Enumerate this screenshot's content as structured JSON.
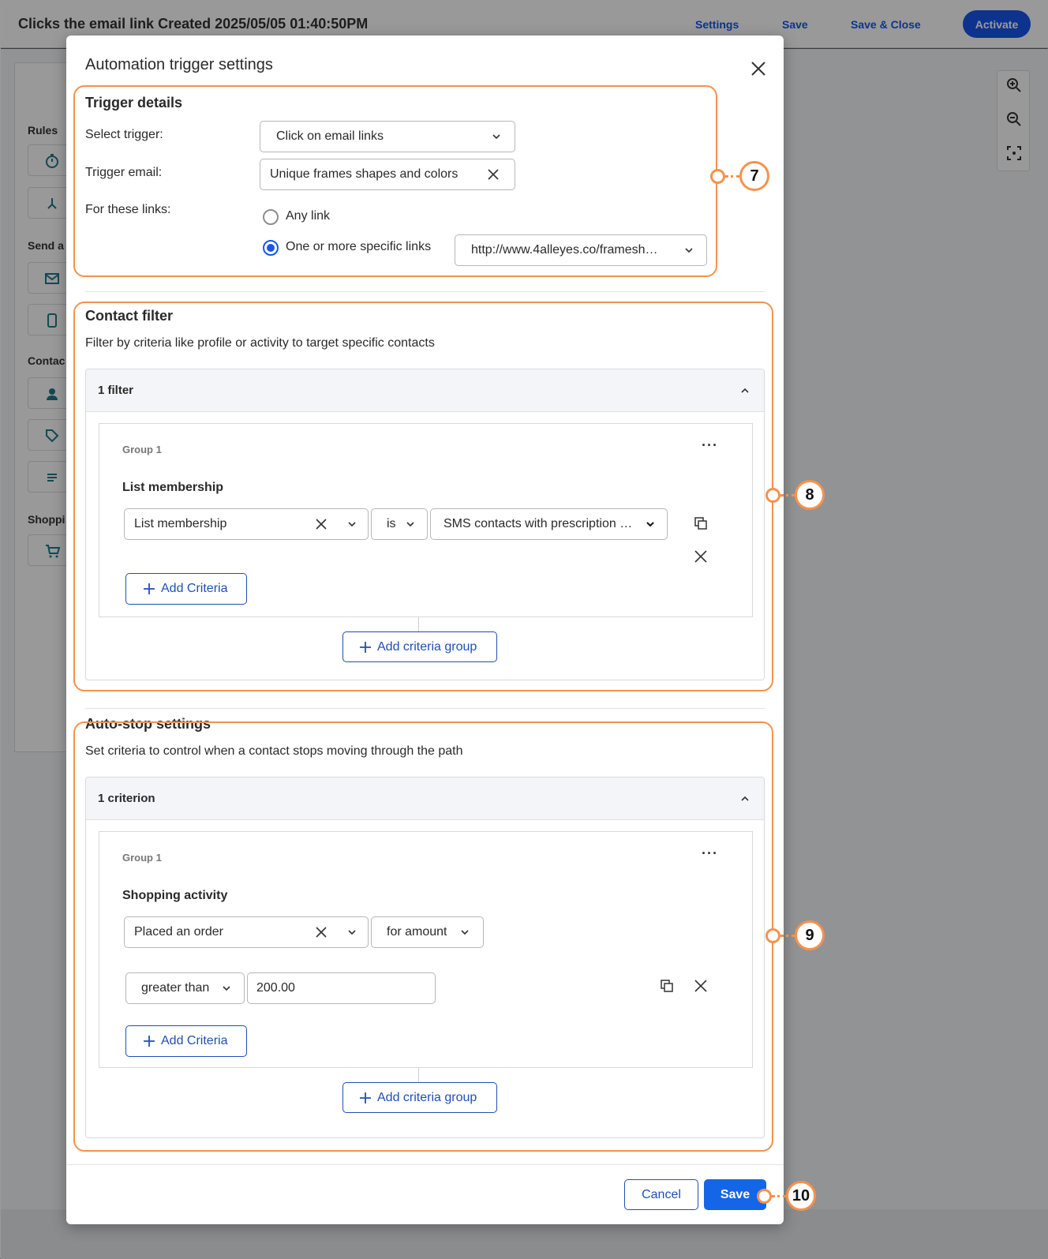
{
  "app": {
    "title": "Clicks the email link Created 2025/05/05 01:40:50PM",
    "nav": {
      "settings": "Settings",
      "save": "Save",
      "save_close": "Save & Close",
      "activate": "Activate"
    },
    "sidebar": {
      "rules": "Rules",
      "send": "Send a",
      "contact": "Contac",
      "shopping": "Shoppi"
    }
  },
  "modal": {
    "title": "Automation trigger settings",
    "trigger": {
      "heading": "Trigger details",
      "select_trigger_label": "Select trigger:",
      "select_trigger_value": "Click on email links",
      "trigger_email_label": "Trigger email:",
      "trigger_email_value": "Unique frames shapes and colors",
      "links_label": "For these links:",
      "any_link": "Any link",
      "specific_links": "One or more specific links",
      "specific_link_value": "http://www.4alleyes.co/framesh…"
    },
    "contact_filter": {
      "heading": "Contact filter",
      "description": "Filter by criteria like profile or activity to target specific contacts",
      "count": "1 filter",
      "group_label": "Group 1",
      "criteria_title": "List membership",
      "field": "List membership",
      "operator": "is",
      "value": "SMS contacts with prescription …",
      "add_criteria": "Add Criteria",
      "add_group": "Add criteria group"
    },
    "auto_stop": {
      "heading": "Auto-stop settings",
      "description": "Set criteria to control when a contact stops moving through the path",
      "count": "1 criterion",
      "group_label": "Group 1",
      "criteria_title": "Shopping activity",
      "field": "Placed an order",
      "qualifier": "for amount",
      "comparison": "greater than",
      "amount": "200.00",
      "add_criteria": "Add Criteria",
      "add_group": "Add criteria group"
    },
    "footer": {
      "cancel": "Cancel",
      "save": "Save"
    }
  },
  "callouts": {
    "trigger": "7",
    "contact_filter": "8",
    "auto_stop": "9",
    "save": "10"
  },
  "colors": {
    "primary": "#1565e8",
    "callout": "#f5924d",
    "link": "#1f4fb5"
  }
}
